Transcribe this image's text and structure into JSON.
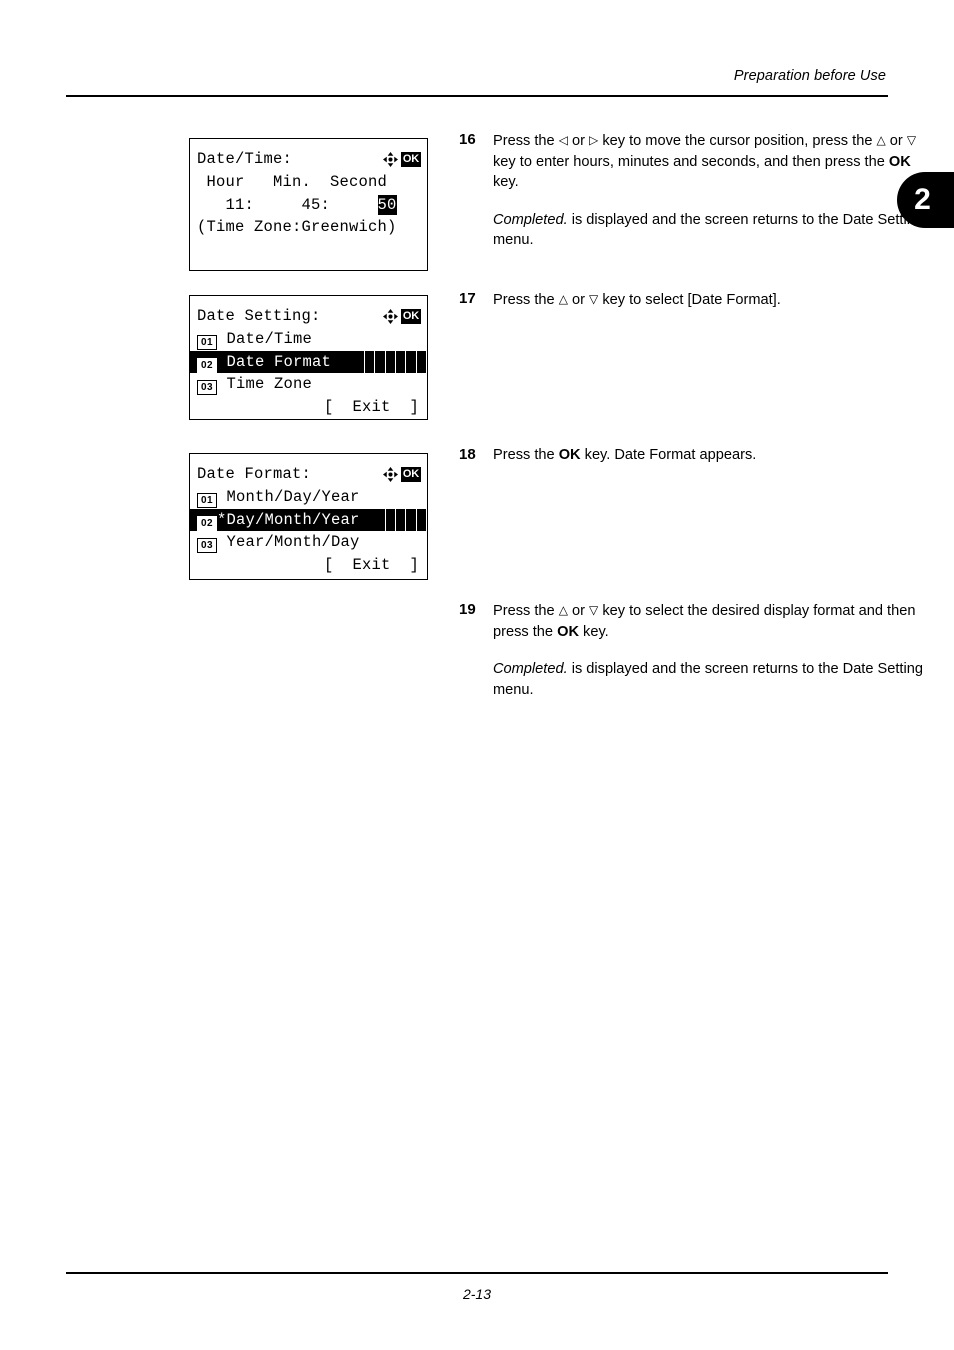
{
  "page": {
    "header_title": "Preparation before Use",
    "footer_page_number": "2-13",
    "chapter_tab": "2"
  },
  "lcd_panels": [
    {
      "id": "date-time",
      "title": "Date/Time:",
      "indicators": [
        "four-way-arrow-icon",
        "ok-key-icon"
      ],
      "ok_label": "OK",
      "rows": [
        " Hour   Min.  Second",
        "   11:     45:     ",
        "(Time Zone:Greenwich)"
      ],
      "cursor_value": "50"
    },
    {
      "id": "date-setting",
      "title": "Date Setting:",
      "indicators": [
        "four-way-arrow-icon",
        "ok-key-icon"
      ],
      "ok_label": "OK",
      "items": [
        {
          "number": "01",
          "label": "Date/Time",
          "selected": false
        },
        {
          "number": "02",
          "label": "Date Format",
          "selected": true
        },
        {
          "number": "03",
          "label": "Time Zone",
          "selected": false
        }
      ],
      "exit_row": "[  Exit  ]"
    },
    {
      "id": "date-format",
      "title": "Date Format:",
      "indicators": [
        "four-way-arrow-icon",
        "ok-key-icon"
      ],
      "ok_label": "OK",
      "items": [
        {
          "number": "01",
          "label": "Month/Day/Year",
          "selected": false
        },
        {
          "number": "02",
          "label": "*Day/Month/Year",
          "selected": true
        },
        {
          "number": "03",
          "label": "Year/Month/Day",
          "selected": false
        }
      ],
      "exit_row": "[  Exit  ]"
    }
  ],
  "steps": [
    {
      "number": "16",
      "paragraphs": [
        {
          "parts": [
            {
              "t": "Press the "
            },
            {
              "t": "◁",
              "glyph": true
            },
            {
              "t": " or "
            },
            {
              "t": "▷",
              "glyph": true
            },
            {
              "t": " key to move the cursor position, press the "
            },
            {
              "t": "△",
              "glyph": true
            },
            {
              "t": " or "
            },
            {
              "t": "▽",
              "glyph": true
            },
            {
              "t": " key to enter hours, minutes and seconds, and then press the "
            },
            {
              "t": "OK",
              "bold": true
            },
            {
              "t": " key."
            }
          ]
        },
        {
          "parts": [
            {
              "t": "Completed.",
              "italic": true
            },
            {
              "t": " is displayed and the screen returns to the Date Setting menu."
            }
          ]
        }
      ]
    },
    {
      "number": "17",
      "paragraphs": [
        {
          "parts": [
            {
              "t": "Press the "
            },
            {
              "t": "△",
              "glyph": true
            },
            {
              "t": " or "
            },
            {
              "t": "▽",
              "glyph": true
            },
            {
              "t": " key to select [Date Format]."
            }
          ]
        }
      ]
    },
    {
      "number": "18",
      "paragraphs": [
        {
          "parts": [
            {
              "t": "Press the "
            },
            {
              "t": "OK",
              "bold": true
            },
            {
              "t": " key. Date Format appears."
            }
          ]
        }
      ]
    },
    {
      "number": "19",
      "paragraphs": [
        {
          "parts": [
            {
              "t": "Press the "
            },
            {
              "t": "△",
              "glyph": true
            },
            {
              "t": " or "
            },
            {
              "t": "▽",
              "glyph": true
            },
            {
              "t": " key to select the desired display format and then press the "
            },
            {
              "t": "OK",
              "bold": true
            },
            {
              "t": " key."
            }
          ]
        },
        {
          "parts": [
            {
              "t": "Completed.",
              "italic": true
            },
            {
              "t": " is displayed and the screen returns to the Date Setting menu."
            }
          ]
        }
      ]
    }
  ]
}
